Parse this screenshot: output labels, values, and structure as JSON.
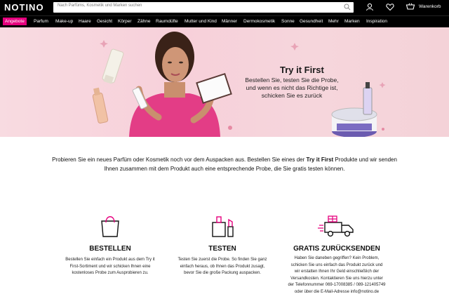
{
  "header": {
    "logo": "NOTINO",
    "search_placeholder": "Nach Parfüms, Kosmetik und Marken suchen",
    "cart_label": "Warenkorb"
  },
  "nav": {
    "sale": "Angebote",
    "items": [
      "Parfum",
      "Make-up",
      "Haare",
      "Gesicht",
      "Körper",
      "Zähne",
      "Raumdüfte",
      "Mutter und Kind",
      "Männer",
      "Dermokosmetik",
      "Sonne",
      "Gesundheit",
      "Mehr",
      "Marken",
      "Inspiration"
    ]
  },
  "hero": {
    "title": "Try it First",
    "text": "Bestellen Sie, testen Sie die Probe, und wenn es nicht das Richtige ist, schicken Sie es zurück",
    "colors": {
      "skin": "#c98f6e",
      "dress": "#e33d86"
    }
  },
  "intro": {
    "text_before": "Probieren Sie ein neues Parfüm oder Kosmetik noch vor dem Auspacken aus. Bestellen Sie eines der ",
    "bold": "Try it First",
    "text_after": " Produkte und wir senden Ihnen zusammen mit dem Produkt auch eine entsprechende Probe, die Sie gratis testen können."
  },
  "features": [
    {
      "title": "BESTELLEN",
      "text": "Bestellen Sie einfach ein Produkt aus dem Try it First-Sortiment und wir schicken Ihnen eine kostenloses Probe zum Ausprobieren zu.",
      "icon": "shopping-bag-icon"
    },
    {
      "title": "TESTEN",
      "text": "Testen Sie zuerst die Probe. So finden Sie ganz einfach heraus, ob Ihnen das Produkt zusagt, bevor Sie die große Packung auspacken.",
      "icon": "cosmetics-icon"
    },
    {
      "title": "GRATIS ZURÜCKSENDEN",
      "text": "Haben Sie daneben gegriffen? Kein Problem, schicken Sie uns einfach das Produkt zurück und wir erstatten Ihnen Ihr Geld einschließlich der Versandkosten. Kontaktieren Sie uns hierzu unter der Telefonnummer 069-17008385 / 089-121405749 oder über die E-Mail-Adresse info@notino.de",
      "icon": "delivery-truck-icon"
    }
  ],
  "accent": "#e6007e"
}
